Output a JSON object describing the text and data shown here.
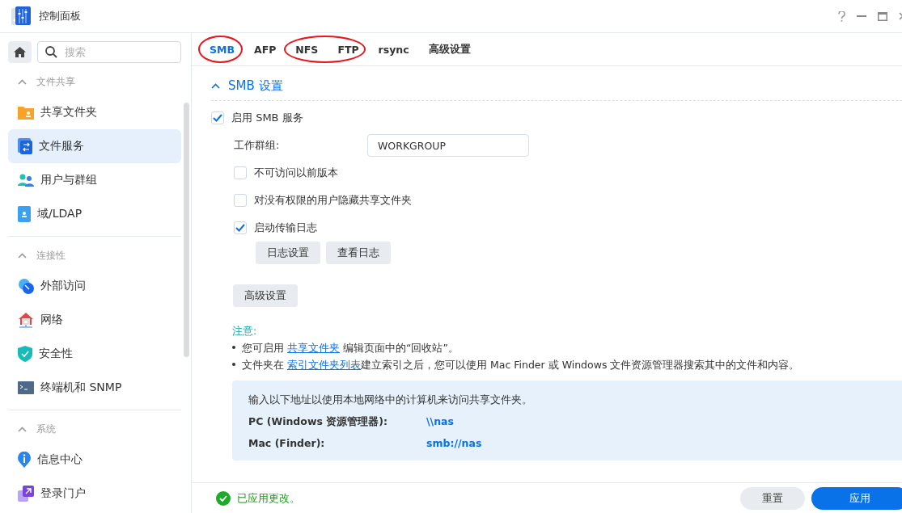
{
  "window": {
    "title": "控制面板"
  },
  "sidebar": {
    "search": {
      "placeholder": "搜索"
    },
    "sections": [
      {
        "title": "文件共享",
        "expanded": true,
        "items": [
          {
            "label": "共享文件夹",
            "kind": "folder",
            "selected": false
          },
          {
            "label": "文件服务",
            "kind": "transfer",
            "selected": true
          },
          {
            "label": "用户与群组",
            "kind": "users",
            "selected": false
          },
          {
            "label": "域/LDAP",
            "kind": "directory",
            "selected": false
          }
        ]
      },
      {
        "title": "连接性",
        "expanded": true,
        "items": [
          {
            "label": "外部访问",
            "kind": "globe",
            "selected": false
          },
          {
            "label": "网络",
            "kind": "house",
            "selected": false
          },
          {
            "label": "安全性",
            "kind": "shield",
            "selected": false
          },
          {
            "label": "终端机和 SNMP",
            "kind": "terminal",
            "selected": false
          }
        ]
      },
      {
        "title": "系统",
        "expanded": true,
        "items": [
          {
            "label": "信息中心",
            "kind": "info",
            "selected": false
          },
          {
            "label": "登录门户",
            "kind": "portal",
            "selected": false
          }
        ]
      }
    ]
  },
  "tabs": [
    {
      "label": "SMB",
      "selected": true
    },
    {
      "label": "AFP",
      "selected": false
    },
    {
      "label": "NFS",
      "selected": false
    },
    {
      "label": "FTP",
      "selected": false
    },
    {
      "label": "rsync",
      "selected": false
    },
    {
      "label": "高级设置",
      "selected": false
    }
  ],
  "smb_section": {
    "title": "SMB 设置",
    "expanded": true,
    "enable": {
      "label": "启用 SMB 服务",
      "checked": true
    },
    "workgroup": {
      "label": "工作群组:",
      "value": "WORKGROUP"
    },
    "options": [
      {
        "label": "不可访问以前版本",
        "checked": false
      },
      {
        "label": "对没有权限的用户隐藏共享文件夹",
        "checked": false
      },
      {
        "label": "启动传输日志",
        "checked": true
      }
    ],
    "log_buttons": [
      "日志设置",
      "查看日志"
    ],
    "advanced_button": "高级设置",
    "notes": {
      "title": "注意:",
      "items": [
        {
          "before": "您可启用 ",
          "link": "共享文件夹",
          "after": " 编辑页面中的“回收站”。"
        },
        {
          "before": "文件夹在 ",
          "link": "索引文件夹列表",
          "after": "建立索引之后，您可以使用 Mac Finder 或 Windows 文件资源管理器搜索其中的文件和内容。"
        }
      ]
    },
    "info_box": {
      "text": "输入以下地址以使用本地网络中的计算机来访问共享文件夹。",
      "rows": [
        {
          "label": "PC (Windows 资源管理器):",
          "value": "\\\\nas"
        },
        {
          "label": "Mac (Finder):",
          "value": "smb://nas"
        }
      ]
    }
  },
  "status_bar": {
    "message": "已应用更改。",
    "buttons": [
      {
        "label": "重置",
        "kind": "secondary"
      },
      {
        "label": "应用",
        "kind": "primary"
      }
    ]
  }
}
